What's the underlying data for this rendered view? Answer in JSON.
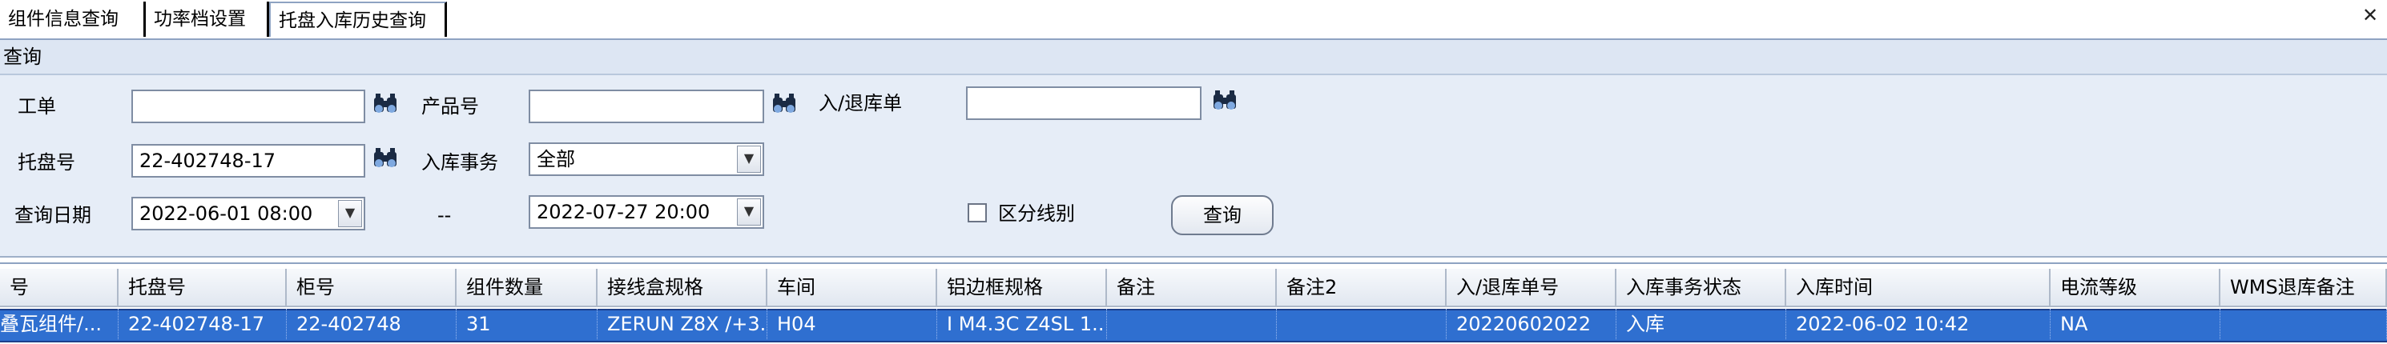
{
  "tabs": [
    {
      "label": "组件信息查询"
    },
    {
      "label": "功率档设置"
    },
    {
      "label": "托盘入库历史查询"
    }
  ],
  "close_icon": "close-icon",
  "query": {
    "section_title": "查询",
    "work_order_label": "工单",
    "work_order_value": "",
    "product_no_label": "产品号",
    "product_no_value": "",
    "in_out_order_label": "入/退库单",
    "in_out_order_value": "",
    "pallet_no_label": "托盘号",
    "pallet_no_value": "22-402748-17",
    "transaction_label": "入库事务",
    "transaction_value": "全部",
    "date_label": "查询日期",
    "date_from": "2022-06-01 08:00",
    "date_separator": "--",
    "date_to": "2022-07-27 20:00",
    "line_checkbox_label": "区分线别",
    "line_checkbox_checked": false,
    "search_button": "查询",
    "lookup_icon": "binoculars-icon",
    "dropdown_icon": "chevron-down-icon"
  },
  "grid": {
    "columns": [
      "号",
      "托盘号",
      "柜号",
      "组件数量",
      "接线盒规格",
      "车间",
      "铝边框规格",
      "备注",
      "备注2",
      "入/退库单号",
      "入库事务状态",
      "入库时间",
      "电流等级",
      "WMS退库备注"
    ],
    "rows": [
      [
        "叠瓦组件/...",
        "22-402748-17",
        "22-402748",
        "31",
        "ZERUN Z8X /+3...",
        "H04",
        "I M4.3C Z4SL 1...",
        "",
        "",
        "20220602022",
        "入库",
        "2022-06-02 10:42",
        "NA",
        ""
      ]
    ]
  },
  "colors": {
    "selected_row": "#2f6fd0",
    "panel_background": "#e6edf7"
  }
}
